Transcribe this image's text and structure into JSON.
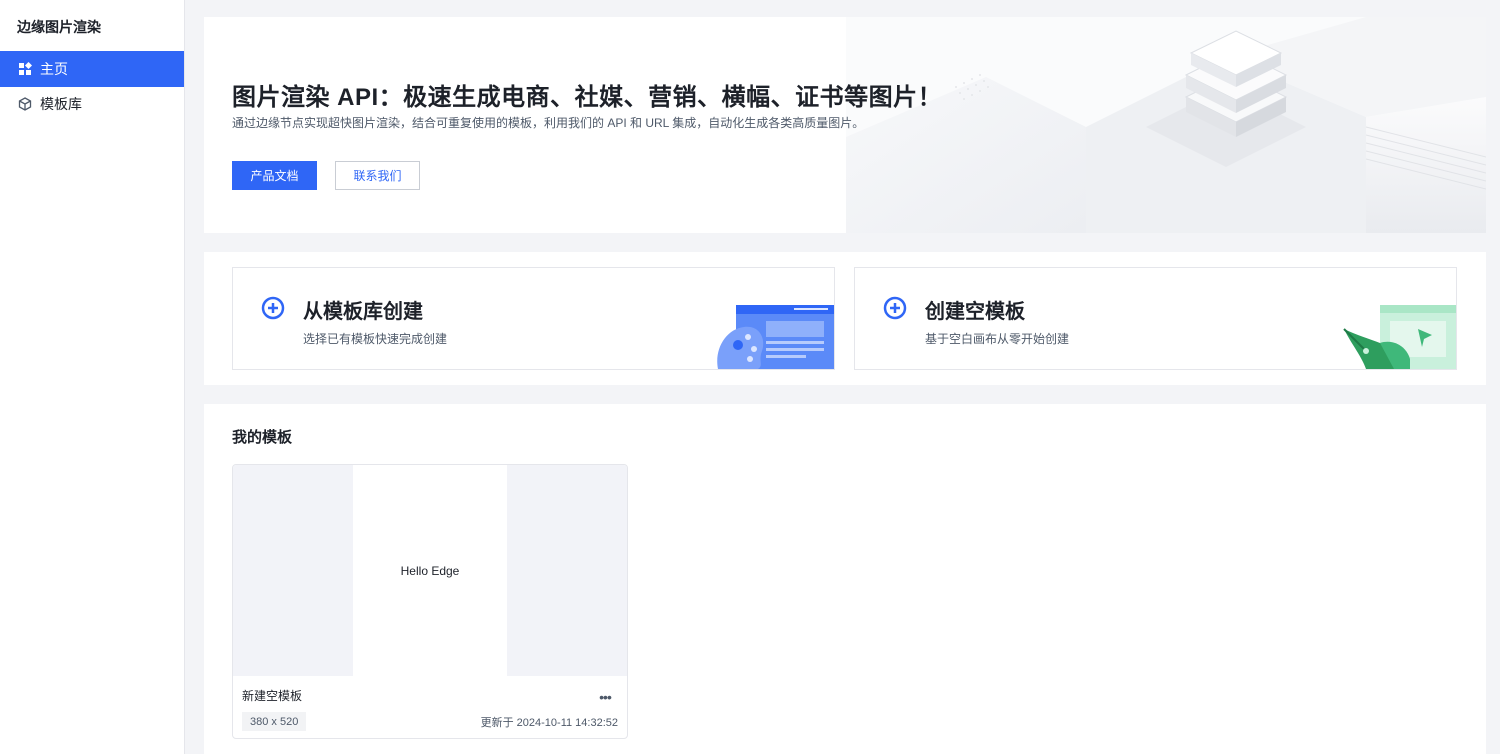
{
  "sidebar": {
    "app_title": "边缘图片渲染",
    "items": [
      {
        "label": "主页",
        "icon": "grid-icon",
        "active": true
      },
      {
        "label": "模板库",
        "icon": "cube-icon",
        "active": false
      }
    ]
  },
  "hero": {
    "title": "图片渲染 API：极速生成电商、社媒、营销、横幅、证书等图片！",
    "subtitle": "通过边缘节点实现超快图片渲染，结合可重复使用的模板，利用我们的 API 和 URL 集成，自动化生成各类高质量图片。",
    "primary_button": "产品文档",
    "secondary_button": "联系我们"
  },
  "create": {
    "from_library": {
      "title": "从模板库创建",
      "desc": "选择已有模板快速完成创建",
      "icon": "plus-circle-icon"
    },
    "blank": {
      "title": "创建空模板",
      "desc": "基于空白画布从零开始创建",
      "icon": "plus-circle-icon"
    }
  },
  "templates": {
    "section_title": "我的模板",
    "items": [
      {
        "preview_text": "Hello Edge",
        "name": "新建空模板",
        "size": "380 x 520",
        "updated": "更新于 2024-10-11 14:32:52"
      }
    ]
  },
  "colors": {
    "accent": "#2f66f6",
    "background": "#f3f4f7",
    "card_art_blue": "#4a7cf7",
    "card_art_green": "#2e9e5e"
  }
}
